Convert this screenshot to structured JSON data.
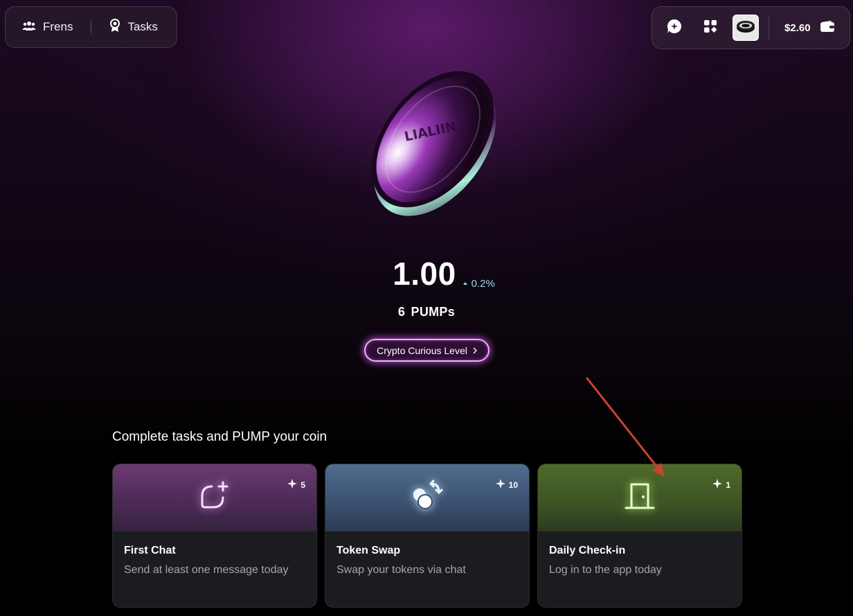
{
  "nav": {
    "frens_label": "Frens",
    "tasks_label": "Tasks"
  },
  "toolbar": {
    "balance": "$2.60"
  },
  "coin": {
    "value": "1.00",
    "change": "0.2%",
    "pumps": "6 PUMPs",
    "level_label": "Crypto Curious Level",
    "coin_text": "LIALIIN"
  },
  "tasks_section": {
    "title": "Complete tasks and PUMP your coin",
    "cards": [
      {
        "points": "5",
        "title": "First Chat",
        "description": "Send at least one message today",
        "icon": "chat-plus-icon",
        "accent": "#f1c9ff"
      },
      {
        "points": "10",
        "title": "Token Swap",
        "description": "Swap your tokens via chat",
        "icon": "swap-coins-icon",
        "accent": "#d8f3ff"
      },
      {
        "points": "1",
        "title": "Daily Check-in",
        "description": "Log in to the app today",
        "icon": "door-icon",
        "accent": "#dcff9e"
      }
    ]
  },
  "colors": {
    "change_up": "#9ad7e6",
    "level_glow": "#d660f0",
    "annotation_arrow": "#c9432e"
  }
}
